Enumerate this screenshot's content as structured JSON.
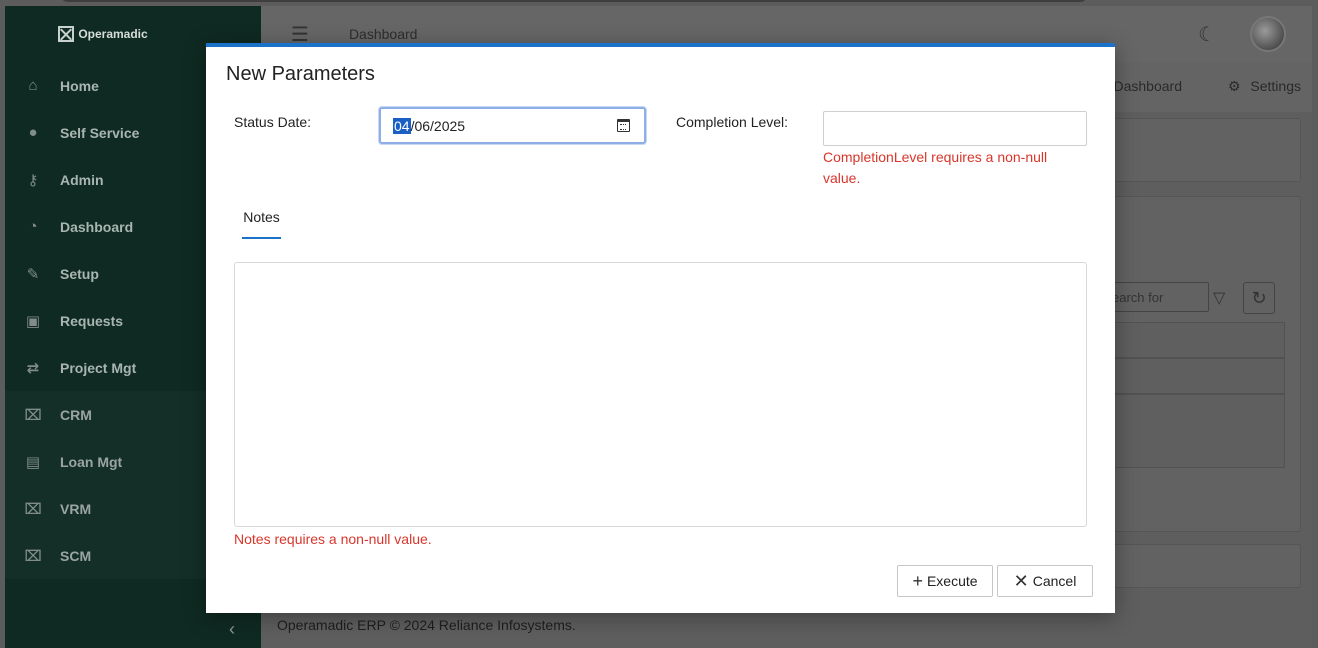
{
  "app": {
    "brand": "Operamadic",
    "sidebar": {
      "items": [
        {
          "label": "Home",
          "icon": "home-icon"
        },
        {
          "label": "Self Service",
          "icon": "user-gear-icon"
        },
        {
          "label": "Admin",
          "icon": "key-icon"
        },
        {
          "label": "Dashboard",
          "icon": "gauge-icon"
        },
        {
          "label": "Setup",
          "icon": "wrench-icon"
        },
        {
          "label": "Requests",
          "icon": "archive-icon"
        },
        {
          "label": "Project Mgt",
          "icon": "arrows-swap-icon"
        },
        {
          "label": "CRM",
          "icon": "contact-frame-icon"
        },
        {
          "label": "Loan Mgt",
          "icon": "money-icon"
        },
        {
          "label": "VRM",
          "icon": "contact-frame-icon"
        },
        {
          "label": "SCM",
          "icon": "contact-frame-icon"
        }
      ]
    },
    "header": {
      "breadcrumb": "Dashboard"
    },
    "subbar": {
      "dashboard": "Dashboard",
      "settings": "Settings"
    },
    "search": {
      "placeholder": "earch for"
    },
    "footer": "Operamadic ERP © 2024 Reliance Infosystems."
  },
  "dialog": {
    "title": "New Parameters",
    "status_date": {
      "label": "Status Date:",
      "month": "04",
      "rest": "/06/2025"
    },
    "completion_level": {
      "label": "Completion Level:",
      "value": "",
      "error": "CompletionLevel requires a non-null value."
    },
    "tabs": [
      {
        "label": "Notes",
        "active": true
      }
    ],
    "notes": {
      "value": "",
      "error": "Notes requires a non-null value."
    },
    "buttons": {
      "execute": "Execute",
      "cancel": "Cancel"
    }
  },
  "colors": {
    "accent": "#1a73c8",
    "error": "#d9362b",
    "sidebar": "#0f2a22"
  }
}
